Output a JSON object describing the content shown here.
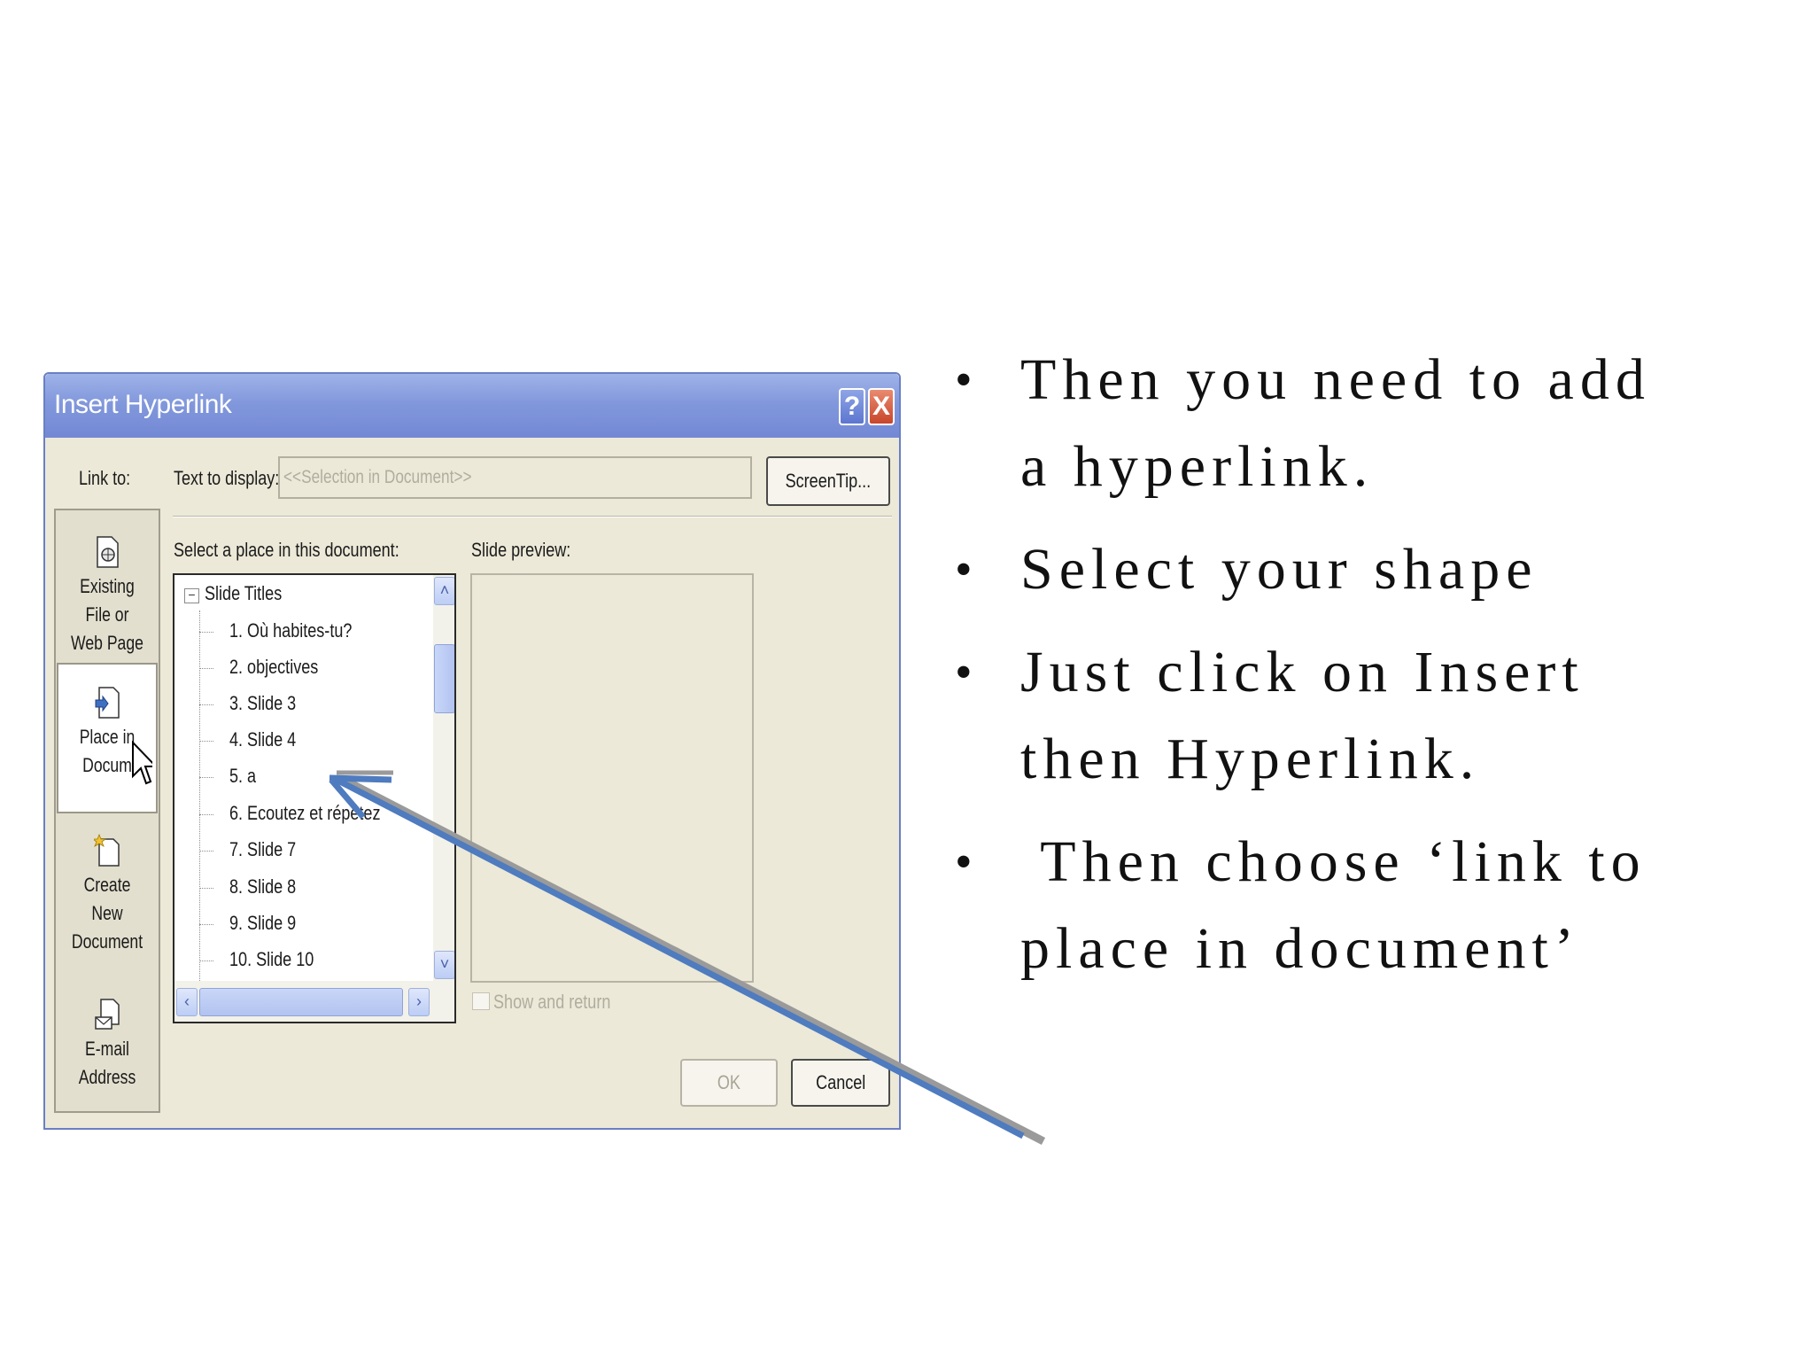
{
  "dialog": {
    "title": "Insert Hyperlink",
    "help_glyph": "?",
    "close_glyph": "X",
    "link_to_label": "Link to:",
    "text_to_display_label": "Text to display:",
    "text_to_display_value": "<<Selection in Document>>",
    "screentip_label": "ScreenTip...",
    "select_place_label": "Select a place in this document:",
    "slide_preview_label": "Slide preview:",
    "show_and_return_label": "Show and return",
    "ok_label": "OK",
    "cancel_label": "Cancel",
    "link_targets": [
      {
        "label_line1": "Existing File or",
        "label_line2": "Web Page",
        "icon": "web-page-icon"
      },
      {
        "label_line1": "Place in",
        "label_line2": "Docum",
        "icon": "place-in-document-icon",
        "selected": true
      },
      {
        "label_line1": "Create New",
        "label_line2": "Document",
        "icon": "new-document-icon"
      },
      {
        "label_line1": "E-mail Address",
        "label_line2": "",
        "icon": "email-address-icon"
      }
    ],
    "tree": {
      "root": "Slide Titles",
      "expander_glyph": "−",
      "items": [
        "1. Où habites-tu?",
        "2. objectives",
        "3. Slide 3",
        "4. Slide 4",
        "5. a",
        "6. Ecoutez et répétez",
        "7. Slide 7",
        "8. Slide 8",
        "9. Slide 9",
        "10. Slide 10"
      ]
    }
  },
  "bullets": [
    {
      "line1": "Then you need to add",
      "line2": "a hyperlink."
    },
    {
      "line1": "Select your shape",
      "line2": ""
    },
    {
      "line1": "Just click on Insert",
      "line2": "then Hyperlink."
    },
    {
      "line1": " Then choose ‘link to",
      "line2": "place in document’"
    }
  ],
  "colors": {
    "titlebar": "#8298dc",
    "dialog_bg": "#ece9d8",
    "arrow": "#4f7bbf"
  }
}
